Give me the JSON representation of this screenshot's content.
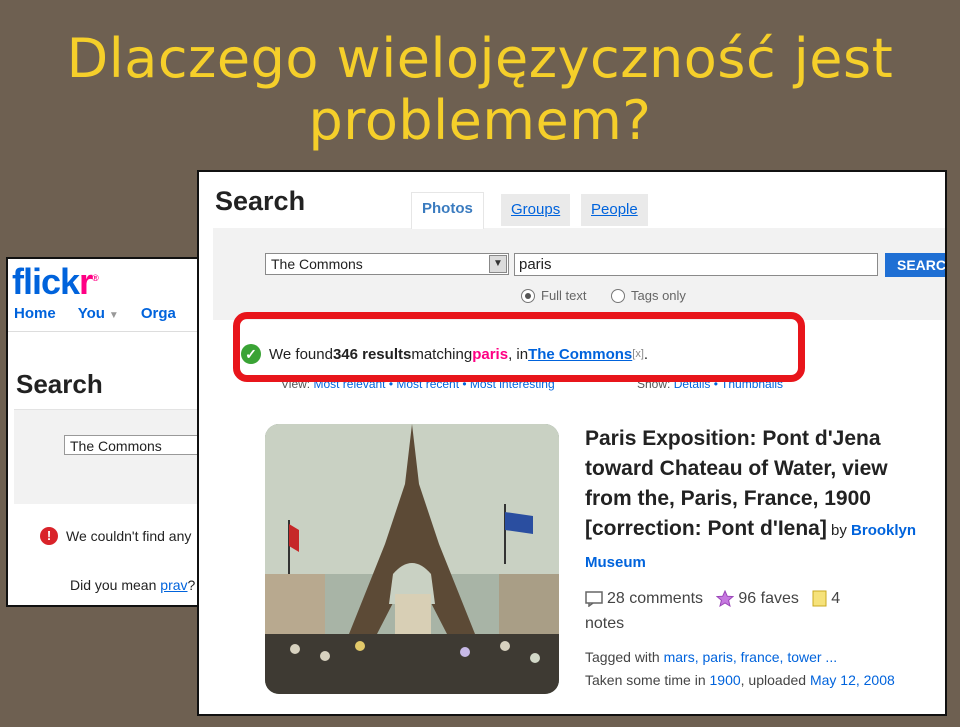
{
  "slide": {
    "title_line1": "Dlaczego wielojęzyczność jest",
    "title_line2": "problemem?"
  },
  "back_shot": {
    "logo_part1": "flick",
    "logo_part2": "r",
    "logo_mark": "®",
    "nav": [
      "Home",
      "You",
      "Orga"
    ],
    "search_title": "Search",
    "select_value": "The Commons",
    "error_text": "We couldn't find any",
    "did_you_mean_prefix": "Did you mean ",
    "did_you_mean_link": "prav",
    "did_you_mean_suffix": "?"
  },
  "front_shot": {
    "search_title": "Search",
    "tabs": [
      "Photos",
      "Groups",
      "People"
    ],
    "select_value": "The Commons",
    "query": "paris",
    "search_button": "SEARC",
    "radio_full_text": "Full text",
    "radio_tags_only": "Tags only",
    "result": {
      "prefix": "We found ",
      "count": "346 results",
      "middle": " matching ",
      "term": "paris",
      "in": ", in ",
      "group": "The Commons",
      "close": "[x]",
      "end": "."
    },
    "view_label": "View: ",
    "view_options": "Most relevant • Most recent • Most interesting",
    "show_label": "Show: ",
    "show_options": "Details • Thumbnails",
    "item": {
      "title": "Paris Exposition: Pont d'Jena toward Chateau of Water, view from the, Paris, France, 1900 [correction: Pont d'Iena]",
      "by": " by ",
      "owner": "Brooklyn Museum",
      "comments": "28 comments",
      "faves": "96 faves",
      "notes_count": "4",
      "notes_label": "notes",
      "tagged_prefix": "Tagged with ",
      "tags": "mars, paris, france, tower ...",
      "taken_prefix": "Taken some time in ",
      "taken_year": "1900",
      "uploaded_prefix": ", uploaded ",
      "uploaded_date": "May 12, 2008"
    }
  },
  "colors": {
    "background": "#6e6051",
    "title": "#f5cf2a",
    "highlight": "#e8151b",
    "flickr_blue": "#0063dc",
    "flickr_pink": "#ff0084"
  }
}
